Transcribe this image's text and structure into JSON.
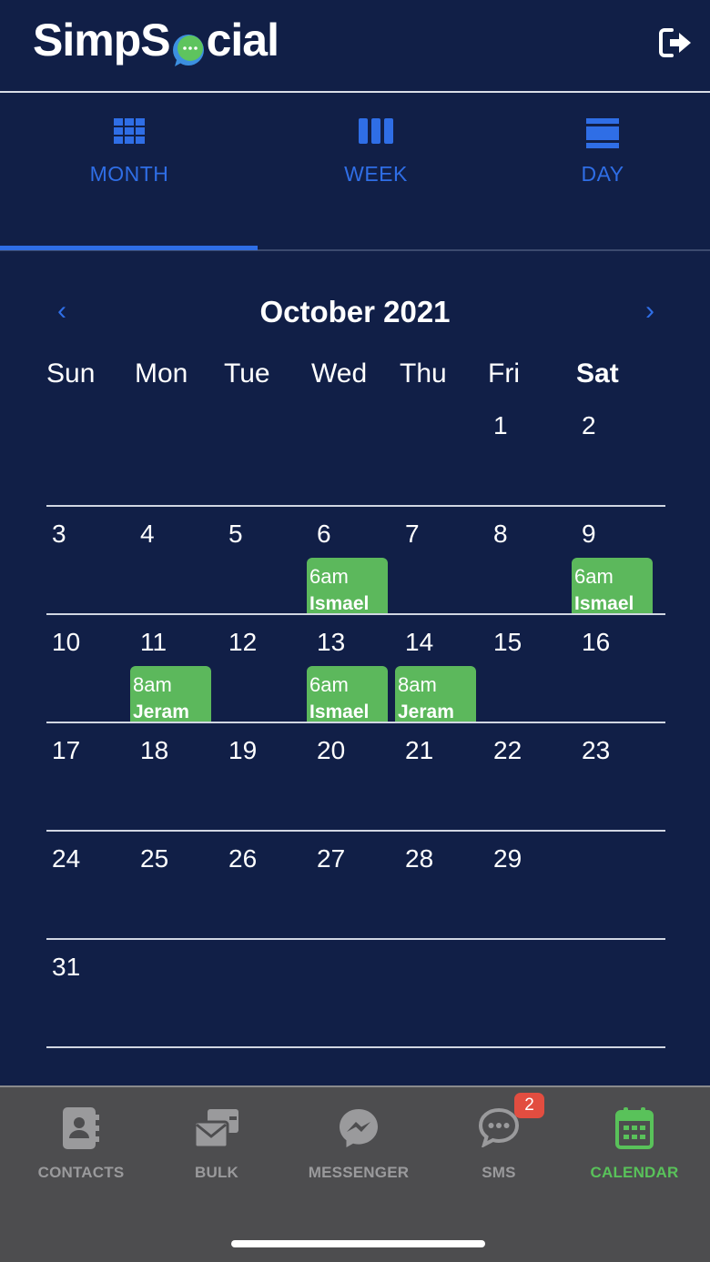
{
  "header": {
    "logo_prefix": "SimpS",
    "logo_suffix": "cial",
    "logout_icon": "sign-out-icon"
  },
  "tabs": [
    {
      "label": "MONTH",
      "icon": "grid-icon",
      "active": true
    },
    {
      "label": "WEEK",
      "icon": "columns-icon",
      "active": false
    },
    {
      "label": "DAY",
      "icon": "rows-icon",
      "active": false
    }
  ],
  "calendar": {
    "month_title": "October 2021",
    "prev_symbol": "‹",
    "next_symbol": "›",
    "weekdays": [
      "Sun",
      "Mon",
      "Tue",
      "Wed",
      "Thu",
      "Fri",
      "Sat"
    ],
    "weeks": [
      [
        "",
        "",
        "",
        "",
        "",
        "1",
        "2"
      ],
      [
        "3",
        "4",
        "5",
        "6",
        "7",
        "8",
        "9"
      ],
      [
        "10",
        "11",
        "12",
        "13",
        "14",
        "15",
        "16"
      ],
      [
        "17",
        "18",
        "19",
        "20",
        "21",
        "22",
        "23"
      ],
      [
        "24",
        "25",
        "26",
        "27",
        "28",
        "29",
        ""
      ],
      [
        "31",
        "",
        "",
        "",
        "",
        "",
        ""
      ]
    ],
    "events": [
      {
        "day": "6",
        "time": "6am",
        "name": "Ismael"
      },
      {
        "day": "9",
        "time": "6am",
        "name": "Ismael"
      },
      {
        "day": "11",
        "time": "8am",
        "name": "Jeram"
      },
      {
        "day": "13",
        "time": "6am",
        "name": "Ismael"
      },
      {
        "day": "14",
        "time": "8am",
        "name": "Jeram"
      }
    ]
  },
  "bottom_nav": {
    "items": [
      {
        "label": "CONTACTS",
        "icon": "contacts-icon",
        "active": false
      },
      {
        "label": "BULK",
        "icon": "bulk-messages-icon",
        "active": false
      },
      {
        "label": "MESSENGER",
        "icon": "messenger-icon",
        "active": false
      },
      {
        "label": "SMS",
        "icon": "sms-icon",
        "active": false
      },
      {
        "label": "CALENDAR",
        "icon": "calendar-icon",
        "active": true
      }
    ],
    "sms_badge": "2"
  },
  "colors": {
    "background": "#111f47",
    "accent": "#2f6ee6",
    "event": "#5cb85c",
    "active_nav": "#59c25a",
    "nav_bar": "#4d4d4f",
    "badge": "#e24d40"
  }
}
